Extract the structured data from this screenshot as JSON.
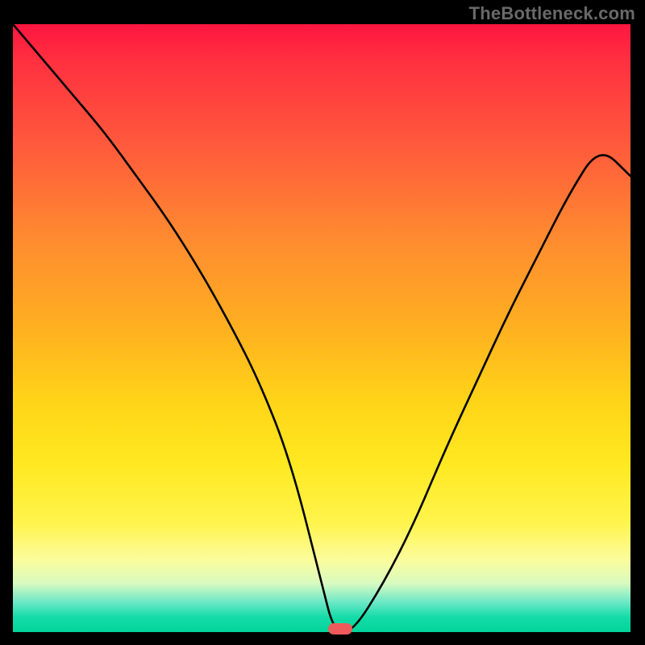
{
  "watermark": "TheBottleneck.com",
  "chart_data": {
    "type": "line",
    "title": "",
    "xlabel": "",
    "ylabel": "",
    "x": [
      0,
      5,
      10,
      15,
      20,
      25,
      30,
      35,
      40,
      45,
      50,
      52,
      55,
      60,
      65,
      70,
      75,
      80,
      85,
      90,
      95,
      100
    ],
    "values": [
      100,
      94,
      88,
      82,
      75,
      68,
      60,
      51,
      41,
      28,
      8,
      0,
      0,
      8,
      18,
      30,
      41,
      52,
      62,
      72,
      80,
      75
    ],
    "xlim": [
      0,
      100
    ],
    "ylim": [
      0,
      100
    ],
    "gradient_colors": {
      "top": "#ff1540",
      "middle": "#ffd418",
      "bottom": "#02d49a"
    },
    "marker": {
      "x": 53,
      "y": 0,
      "color": "#f05a5a"
    }
  }
}
